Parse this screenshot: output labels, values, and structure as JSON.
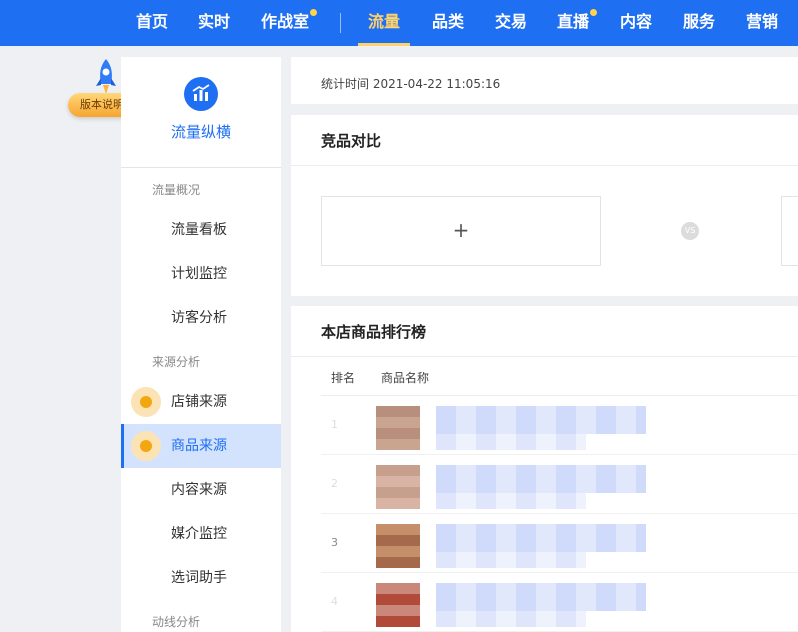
{
  "topnav": {
    "items": [
      {
        "label": "首页",
        "active": false,
        "dot": false
      },
      {
        "label": "实时",
        "active": false,
        "dot": false
      },
      {
        "label": "作战室",
        "active": false,
        "dot": true
      },
      {
        "label": "流量",
        "active": true,
        "dot": false
      },
      {
        "label": "品类",
        "active": false,
        "dot": false
      },
      {
        "label": "交易",
        "active": false,
        "dot": false
      },
      {
        "label": "直播",
        "active": false,
        "dot": true
      },
      {
        "label": "内容",
        "active": false,
        "dot": false
      },
      {
        "label": "服务",
        "active": false,
        "dot": false
      },
      {
        "label": "营销",
        "active": false,
        "dot": false
      }
    ]
  },
  "version_badge": {
    "label": "版本说明",
    "icon": "rocket-icon"
  },
  "sidebar": {
    "title": "流量纵横",
    "logo_icon": "chart-bars-icon",
    "groups": {
      "overview": "流量概况",
      "source": "来源分析",
      "path": "动线分析"
    },
    "items": {
      "dashboard": "流量看板",
      "plan": "计划监控",
      "visitor": "访客分析",
      "shop_source": "店铺来源",
      "product_source": "商品来源",
      "content_source": "内容来源",
      "media": "媒介监控",
      "keyword": "选词助手"
    },
    "active_item": "商品来源"
  },
  "stats": {
    "time_text": "统计时间 2021-04-22 11:05:16"
  },
  "compare": {
    "title": "竞品对比",
    "add_symbol": "+",
    "vs_label": "VS"
  },
  "ranking": {
    "title": "本店商品排行榜",
    "columns": [
      "排名",
      "商品名称"
    ],
    "rows": [
      {
        "rank": "1"
      },
      {
        "rank": "2"
      },
      {
        "rank": "3"
      },
      {
        "rank": "4"
      }
    ]
  },
  "colors": {
    "primary": "#1f6ff2",
    "accent": "#ffd36a",
    "badge": "#f2a70e"
  }
}
